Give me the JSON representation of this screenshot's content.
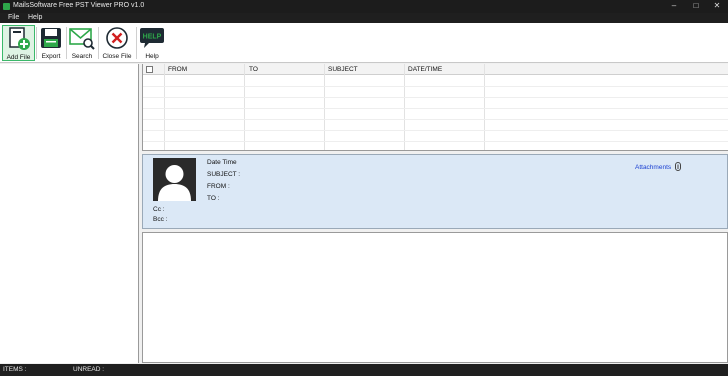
{
  "window": {
    "title": "MailsSoftware Free PST Viewer PRO v1.0",
    "controls": {
      "minimize": "–",
      "maximize": "□",
      "close": "✕"
    }
  },
  "menu": {
    "file": "File",
    "help": "Help"
  },
  "toolbar": {
    "add_file": "Add File",
    "export": "Export",
    "search": "Search",
    "close_file": "Close File",
    "help": "Help",
    "help_icon_text": "HELP",
    "colors": {
      "accent": "#2ea84a",
      "close_red": "#d11f1f",
      "export_dark": "#1e2a33"
    }
  },
  "mail_list": {
    "columns": [
      "FROM",
      "TO",
      "SUBJECT",
      "DATE/TIME"
    ]
  },
  "mail_header": {
    "date_time": "Date Time",
    "subject": "SUBJECT :",
    "from": "FROM :",
    "to": "TO :",
    "cc": "Cc :",
    "bcc": "Bcc :",
    "attachments": "Attachments",
    "colors": {
      "background": "#dbe8f6",
      "link": "#1a3fd1"
    }
  },
  "status": {
    "items": "ITEMS :",
    "unread": "UNREAD :"
  }
}
